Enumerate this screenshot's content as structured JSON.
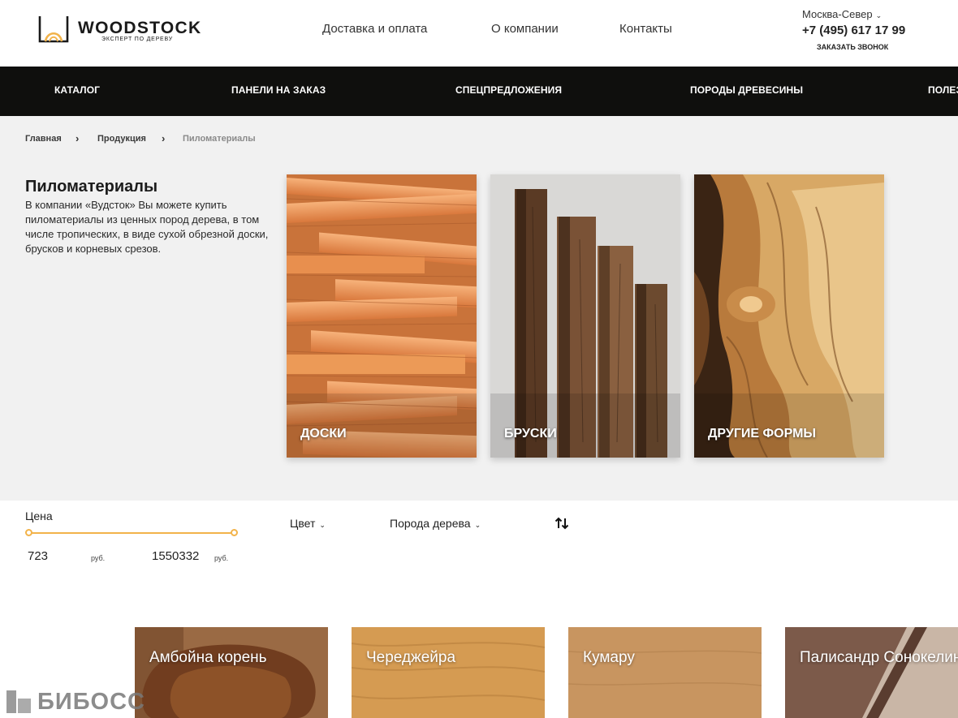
{
  "header": {
    "logo": {
      "name": "WOODSTOCK",
      "tagline": "ЭКСПЕРТ ПО ДЕРЕВУ"
    },
    "nav": [
      "Доставка и оплата",
      "О компании",
      "Контакты"
    ],
    "city": "Москва-Север",
    "phone": "+7 (495) 617 17 99",
    "callback": "ЗАКАЗАТЬ ЗВОНОК"
  },
  "menu": [
    "КАТАЛОГ",
    "ПАНЕЛИ НА ЗАКАЗ",
    "СПЕЦПРЕДЛОЖЕНИЯ",
    "ПОРОДЫ ДРЕВЕСИНЫ",
    "ПОЛЕЗ"
  ],
  "breadcrumbs": [
    "Главная",
    "Продукция",
    "Пиломатериалы"
  ],
  "category": {
    "title": "Пиломатериалы",
    "description": "В компании «Вудсток» Вы можете купить пиломатериалы из ценных пород дерева, в том числе тропических, в виде сухой обрезной доски, брусков и корневых срезов."
  },
  "category_cards": [
    "ДОСКИ",
    "БРУСКИ",
    "ДРУГИЕ ФОРМЫ"
  ],
  "filters": {
    "price_label": "Цена",
    "price_min": "723",
    "price_max": "1550332",
    "currency": "руб.",
    "color_label": "Цвет",
    "wood_label": "Порода дерева",
    "accent_color": "#f2b34a"
  },
  "products": [
    "Амбойна корень",
    "Череджейра",
    "Кумару",
    "Палисандр Сонокелинг"
  ],
  "watermark": "БИБОСС"
}
